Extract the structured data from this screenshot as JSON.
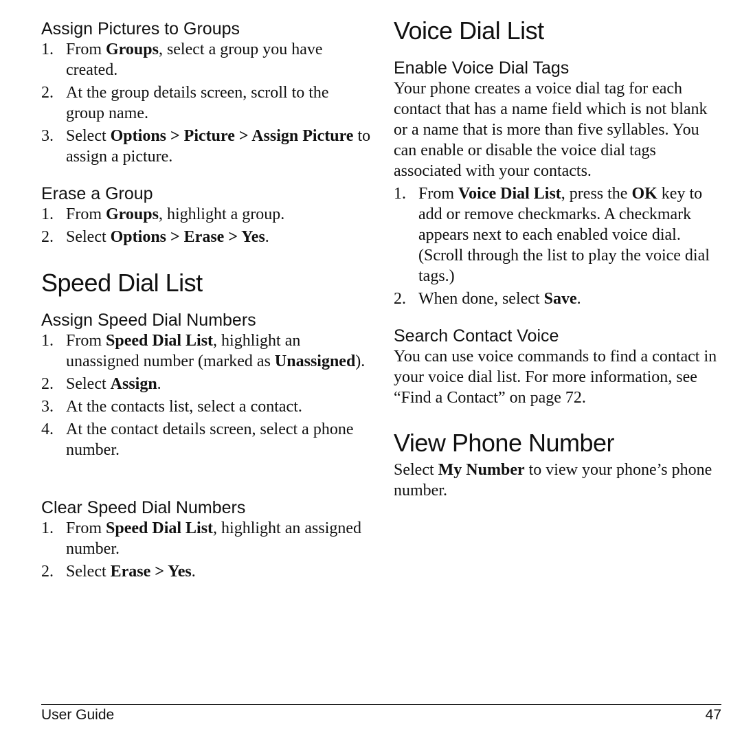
{
  "left_column": {
    "assign_pictures": {
      "heading": "Assign Pictures to Groups",
      "steps": [
        {
          "num": "1.",
          "segments": [
            {
              "t": "From "
            },
            {
              "t": "Groups",
              "b": true
            },
            {
              "t": ", select a group you have created."
            }
          ]
        },
        {
          "num": "2.",
          "segments": [
            {
              "t": "At the group details screen, scroll to the group name."
            }
          ]
        },
        {
          "num": "3.",
          "segments": [
            {
              "t": "Select "
            },
            {
              "t": "Options > Picture > Assign Picture",
              "b": true
            },
            {
              "t": " to assign a picture."
            }
          ]
        }
      ]
    },
    "erase_group": {
      "heading": "Erase a Group",
      "steps": [
        {
          "num": "1.",
          "segments": [
            {
              "t": "From "
            },
            {
              "t": "Groups",
              "b": true
            },
            {
              "t": ", highlight a group."
            }
          ]
        },
        {
          "num": "2.",
          "segments": [
            {
              "t": "Select "
            },
            {
              "t": "Options > Erase > Yes",
              "b": true
            },
            {
              "t": "."
            }
          ]
        }
      ]
    },
    "speed_dial_title": "Speed Dial List",
    "assign_speed_dial": {
      "heading": "Assign Speed Dial Numbers",
      "steps": [
        {
          "num": "1.",
          "segments": [
            {
              "t": "From "
            },
            {
              "t": "Speed Dial List",
              "b": true
            },
            {
              "t": ", highlight an unassigned number (marked as "
            },
            {
              "t": "Unassigned",
              "b": true
            },
            {
              "t": ")."
            }
          ]
        },
        {
          "num": "2.",
          "segments": [
            {
              "t": "Select "
            },
            {
              "t": "Assign",
              "b": true
            },
            {
              "t": "."
            }
          ]
        },
        {
          "num": "3.",
          "segments": [
            {
              "t": "At the contacts list, select a contact."
            }
          ]
        },
        {
          "num": "4.",
          "segments": [
            {
              "t": "At the contact details screen, select a phone number."
            }
          ]
        }
      ]
    },
    "clear_speed_dial": {
      "heading": "Clear Speed Dial Numbers",
      "steps": [
        {
          "num": "1.",
          "segments": [
            {
              "t": "From "
            },
            {
              "t": "Speed Dial List",
              "b": true
            },
            {
              "t": ", highlight an assigned number."
            }
          ]
        },
        {
          "num": "2.",
          "segments": [
            {
              "t": "Select "
            },
            {
              "t": "Erase > Yes",
              "b": true
            },
            {
              "t": "."
            }
          ]
        }
      ]
    }
  },
  "right_column": {
    "voice_dial_title": "Voice Dial List",
    "enable_tags": {
      "heading": "Enable Voice Dial Tags",
      "paragraph": "Your phone creates a voice dial tag for each contact that has a name field which is not blank or a name that is more than five syllables. You can enable or disable the voice dial tags associated with your contacts.",
      "steps": [
        {
          "num": "1.",
          "segments": [
            {
              "t": "From "
            },
            {
              "t": "Voice Dial List",
              "b": true
            },
            {
              "t": ", press the "
            },
            {
              "t": "OK",
              "b": true
            },
            {
              "t": " key to add or remove checkmarks. A checkmark appears next to each enabled voice dial. (Scroll through the list to play the voice dial tags.)"
            }
          ]
        },
        {
          "num": "2.",
          "segments": [
            {
              "t": "When done, select "
            },
            {
              "t": "Save",
              "b": true
            },
            {
              "t": "."
            }
          ]
        }
      ]
    },
    "search_voice": {
      "heading": "Search Contact Voice",
      "paragraph": "You can use voice commands to find a contact in your voice dial list. For more information, see “Find a Contact” on page 72."
    },
    "view_number_title": "View Phone Number",
    "view_number": {
      "segments": [
        {
          "t": "Select "
        },
        {
          "t": "My Number",
          "b": true
        },
        {
          "t": " to view your phone’s phone number."
        }
      ]
    }
  },
  "footer": {
    "left": "User Guide",
    "page_number": "47"
  }
}
